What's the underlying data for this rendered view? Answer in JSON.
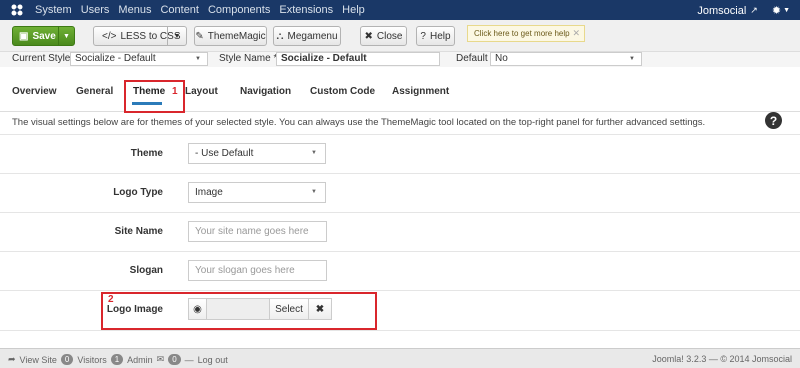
{
  "navbar": {
    "menu": [
      "System",
      "Users",
      "Menus",
      "Content",
      "Components",
      "Extensions",
      "Help"
    ],
    "site_name": "Jomsocial",
    "site_link_icon": "external-link-icon",
    "settings_icon": "gear-icon"
  },
  "toolbar": {
    "save_label": "Save",
    "less_label": "LESS to CSS",
    "thememagic_label": "ThemeMagic",
    "megamenu_label": "Megamenu",
    "close_label": "Close",
    "help_label": "Help",
    "help_banner": "Click here to get more help"
  },
  "style_row": {
    "current_style_label": "Current Style",
    "current_style_value": "Socialize - Default",
    "style_name_label": "Style Name *",
    "style_name_value": "Socialize - Default",
    "default_label": "Default",
    "default_value": "No"
  },
  "tabs": [
    "Overview",
    "General",
    "Theme",
    "Layout",
    "Navigation",
    "Custom Code",
    "Assignment"
  ],
  "active_tab": "Theme",
  "info_text": "The visual settings below are for themes of your selected style. You can always use the ThemeMagic tool located on the top-right panel for further advanced settings.",
  "form": {
    "theme_label": "Theme",
    "theme_value": "- Use Default",
    "logo_type_label": "Logo Type",
    "logo_type_value": "Image",
    "site_name_label": "Site Name",
    "site_name_placeholder": "Your site name goes here",
    "slogan_label": "Slogan",
    "slogan_placeholder": "Your slogan goes here",
    "logo_image_label": "Logo Image",
    "logo_image_select": "Select",
    "logo_image_clear": "✖"
  },
  "annotations": [
    "1",
    "2"
  ],
  "footer": {
    "view_site": "View Site",
    "visitors_count": "0",
    "visitors_label": "Visitors",
    "admin_count": "1",
    "admin_label": "Admin",
    "messages_count": "0",
    "logout_label": "Log out",
    "version": "Joomla! 3.2.3 — © 2014 Jomsocial"
  },
  "colors": {
    "navbar": "#1a3867",
    "save_button": "#5a9c27",
    "annotation": "#d9262c",
    "active_tab_underline": "#2b7bb9"
  }
}
